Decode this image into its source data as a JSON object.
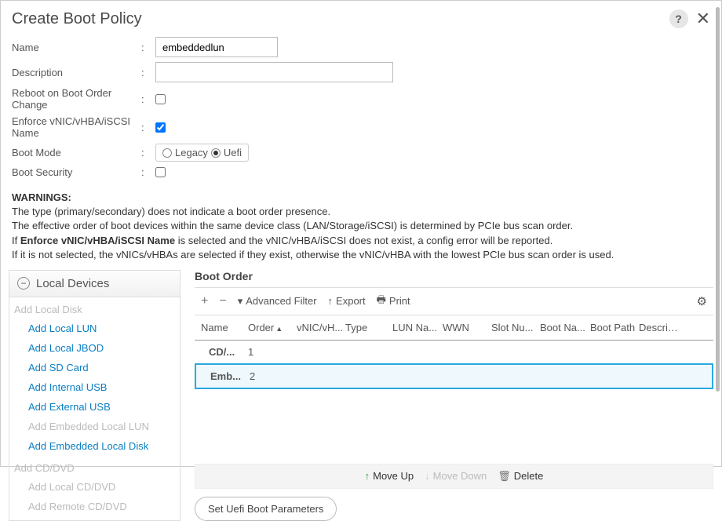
{
  "dialog": {
    "title": "Create Boot Policy"
  },
  "form": {
    "name_label": "Name",
    "name_value": "embeddedlun",
    "desc_label": "Description",
    "desc_value": "",
    "reboot_label": "Reboot on Boot Order Change",
    "reboot_checked": false,
    "enforce_label": "Enforce vNIC/vHBA/iSCSI Name",
    "enforce_checked": true,
    "bootmode_label": "Boot Mode",
    "bootmode_options": {
      "legacy": "Legacy",
      "uefi": "Uefi"
    },
    "bootmode_value": "uefi",
    "bootsec_label": "Boot Security",
    "bootsec_checked": false
  },
  "warnings": {
    "heading": "WARNINGS:",
    "l1": "The type (primary/secondary) does not indicate a boot order presence.",
    "l2": "The effective order of boot devices within the same device class (LAN/Storage/iSCSI) is determined by PCIe bus scan order.",
    "l3a": "If ",
    "l3b": "Enforce vNIC/vHBA/iSCSI Name",
    "l3c": " is selected and the vNIC/vHBA/iSCSI does not exist, a config error will be reported.",
    "l4": "If it is not selected, the vNICs/vHBAs are selected if they exist, otherwise the vNIC/vHBA with the lowest PCIe bus scan order is used."
  },
  "sidebar": {
    "header": "Local Devices",
    "group1": "Add Local Disk",
    "items1": [
      {
        "label": "Add Local LUN",
        "disabled": false
      },
      {
        "label": "Add Local JBOD",
        "disabled": false
      },
      {
        "label": "Add SD Card",
        "disabled": false
      },
      {
        "label": "Add Internal USB",
        "disabled": false
      },
      {
        "label": "Add External USB",
        "disabled": false
      },
      {
        "label": "Add Embedded Local LUN",
        "disabled": true
      },
      {
        "label": "Add Embedded Local Disk",
        "disabled": false
      }
    ],
    "group2": "Add CD/DVD",
    "items2": [
      {
        "label": "Add Local CD/DVD",
        "disabled": true
      },
      {
        "label": "Add Remote CD/DVD",
        "disabled": true
      }
    ]
  },
  "main": {
    "title": "Boot Order",
    "toolbar": {
      "adv_filter": "Advanced Filter",
      "export": "Export",
      "print": "Print"
    },
    "columns": {
      "name": "Name",
      "order": "Order",
      "vnic": "vNIC/vH...",
      "type": "Type",
      "lun": "LUN Na...",
      "wwn": "WWN",
      "slot": "Slot Nu...",
      "bootna": "Boot Na...",
      "bootpath": "Boot Path",
      "desc": "Descript..."
    },
    "rows": [
      {
        "name": "CD/...",
        "order": "1",
        "selected": false
      },
      {
        "name": "Emb...",
        "order": "2",
        "selected": true
      }
    ],
    "footer": {
      "moveup": "Move Up",
      "movedown": "Move Down",
      "delete": "Delete"
    },
    "uefi_btn": "Set Uefi Boot Parameters"
  }
}
